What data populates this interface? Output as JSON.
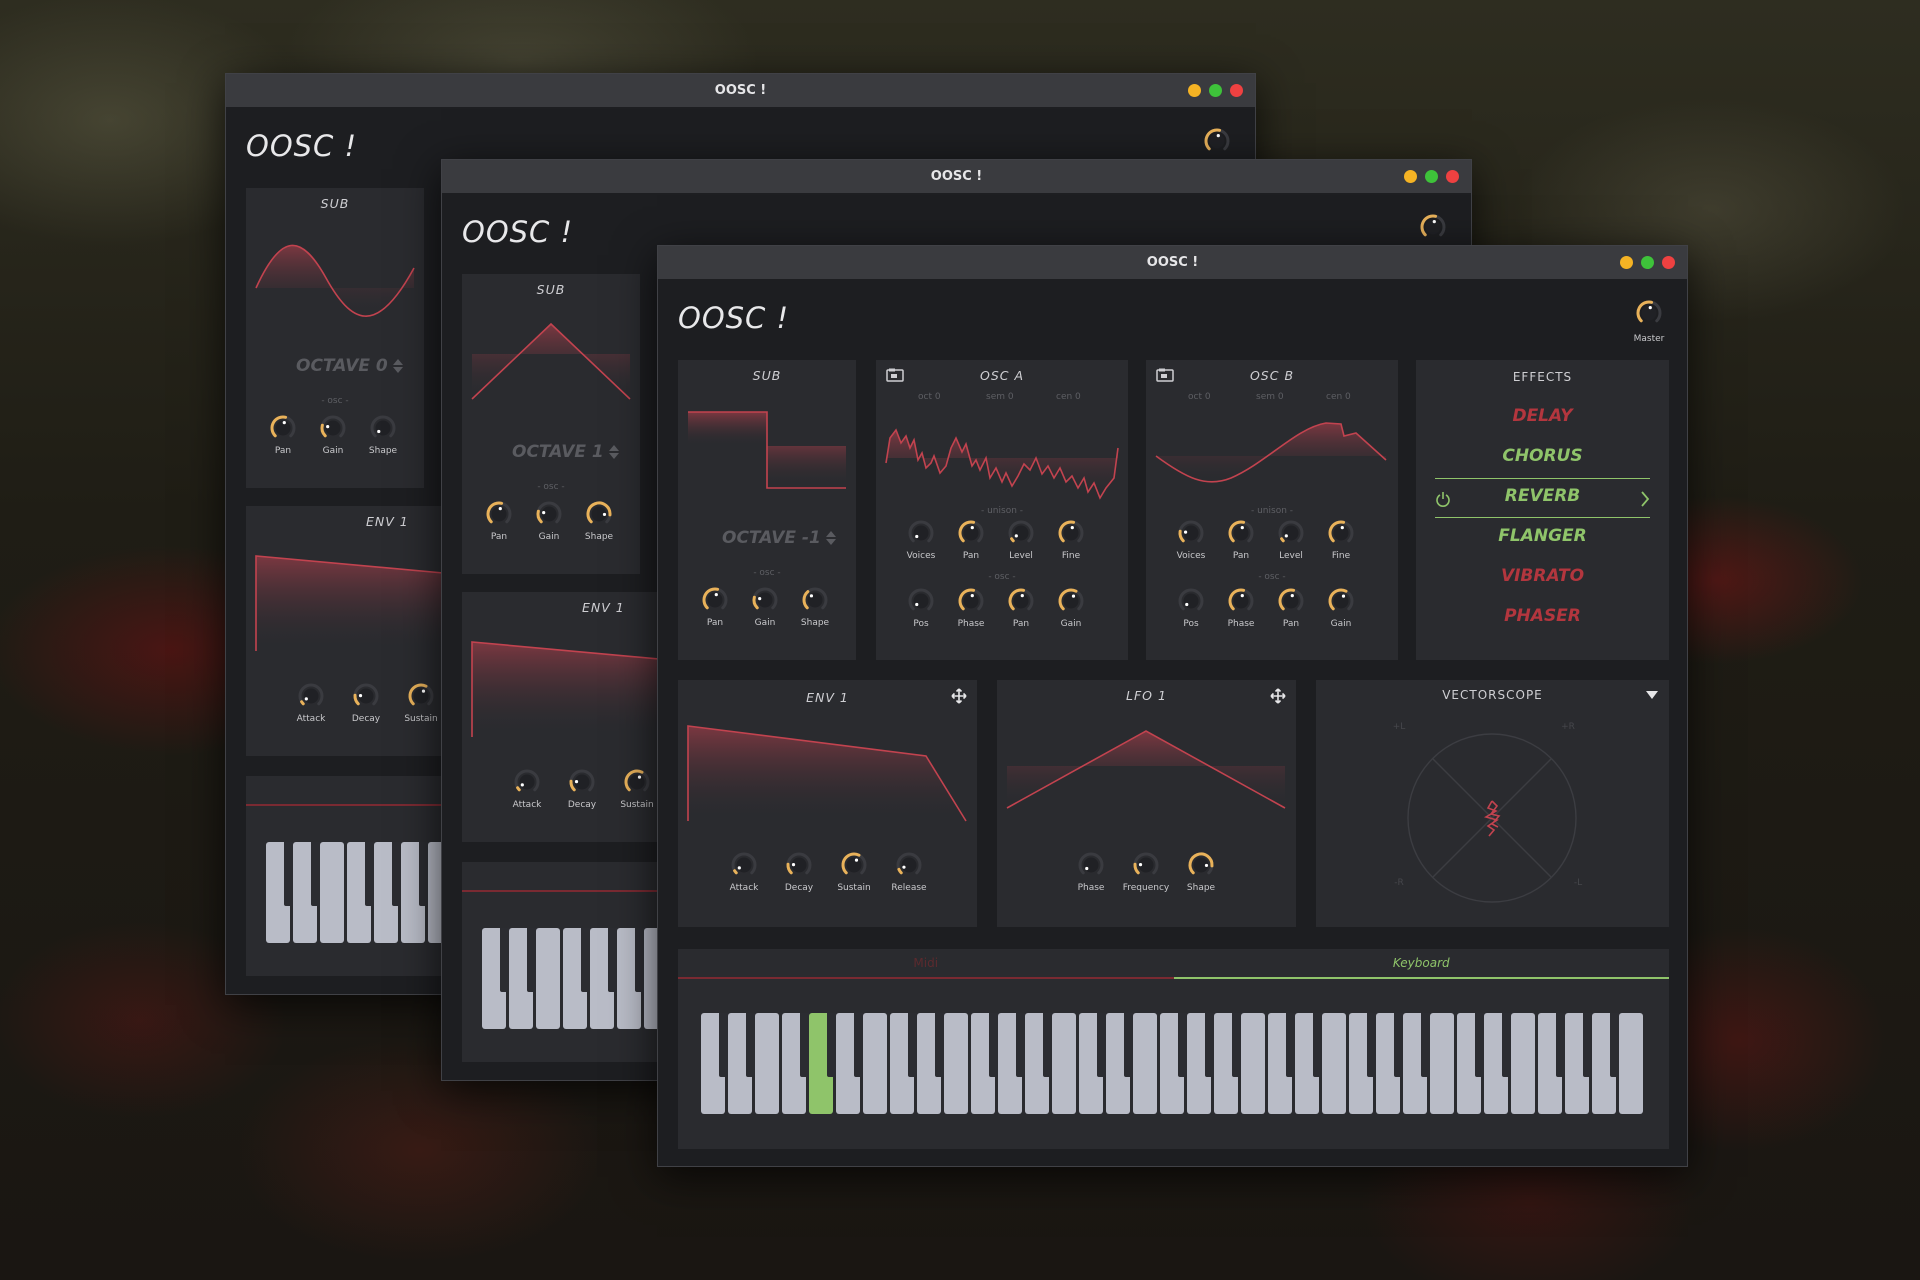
{
  "brand": "OOSC !",
  "window_title": "OOSC !",
  "master_label": "Master",
  "colors": {
    "accent": "#e9b25a",
    "wave": "#c2434f",
    "fx_on": "#8fc46a",
    "fx_off": "#b3363e",
    "key_active": "#8fc46a"
  },
  "back_window": {
    "sub": {
      "title": "SUB",
      "octave": "OCTAVE 0",
      "section": "- osc -",
      "knobs": [
        "Pan",
        "Gain",
        "Shape"
      ]
    },
    "env": {
      "title": "ENV 1",
      "knobs": [
        "Attack",
        "Decay",
        "Sustain"
      ]
    }
  },
  "middle_window": {
    "sub": {
      "title": "SUB",
      "octave": "OCTAVE 1",
      "section": "- osc -",
      "knobs": [
        "Pan",
        "Gain",
        "Shape"
      ]
    },
    "env": {
      "title": "ENV 1",
      "knobs": [
        "Attack",
        "Decay",
        "Sustain"
      ]
    }
  },
  "front_window": {
    "sub": {
      "title": "SUB",
      "octave": "OCTAVE -1",
      "section": "- osc -",
      "knobs": [
        "Pan",
        "Gain",
        "Shape"
      ]
    },
    "osc_a": {
      "title": "OSC A",
      "oct": "oct 0",
      "sem": "sem 0",
      "cen": "cen 0",
      "unison": "- unison -",
      "osc": "- osc -",
      "knobs_top": [
        "Voices",
        "Pan",
        "Level",
        "Fine"
      ],
      "knobs_bottom": [
        "Pos",
        "Phase",
        "Pan",
        "Gain"
      ]
    },
    "osc_b": {
      "title": "OSC B",
      "oct": "oct 0",
      "sem": "sem 0",
      "cen": "cen 0",
      "unison": "- unison -",
      "osc": "- osc -",
      "knobs_top": [
        "Voices",
        "Pan",
        "Level",
        "Fine"
      ],
      "knobs_bottom": [
        "Pos",
        "Phase",
        "Pan",
        "Gain"
      ]
    },
    "effects": {
      "title": "EFFECTS",
      "items": [
        {
          "label": "DELAY",
          "enabled": false
        },
        {
          "label": "CHORUS",
          "enabled": true
        },
        {
          "label": "REVERB",
          "enabled": true,
          "selected": true
        },
        {
          "label": "FLANGER",
          "enabled": true
        },
        {
          "label": "VIBRATO",
          "enabled": false
        },
        {
          "label": "PHASER",
          "enabled": false
        }
      ]
    },
    "env": {
      "title": "ENV 1",
      "knobs": [
        "Attack",
        "Decay",
        "Sustain",
        "Release"
      ]
    },
    "lfo": {
      "title": "LFO 1",
      "knobs": [
        "Phase",
        "Frequency",
        "Shape"
      ]
    },
    "vectorscope": {
      "title": "VECTORSCOPE",
      "labels": [
        "+L",
        "+R",
        "-R",
        "-L"
      ]
    },
    "keyboard": {
      "tabs": [
        "Midi",
        "Keyboard"
      ],
      "active_tab": "Keyboard",
      "white_keys": 35,
      "active_key_index": 4
    }
  }
}
